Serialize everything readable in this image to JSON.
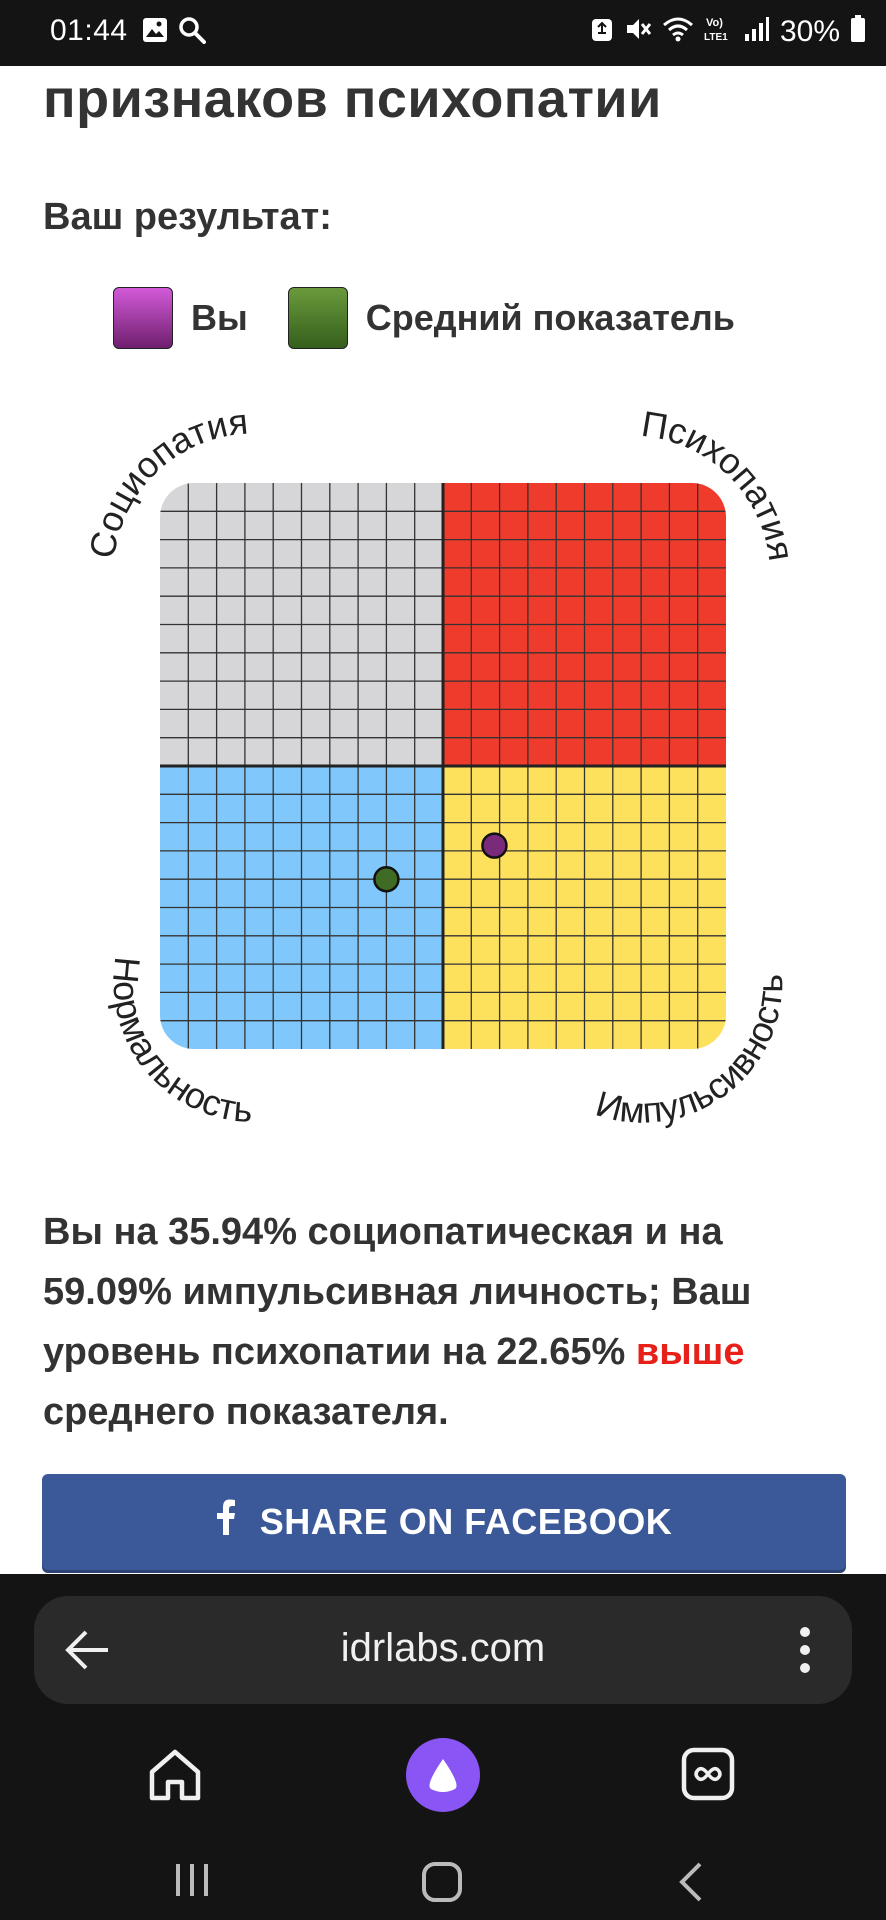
{
  "status_bar": {
    "time": "01:44",
    "left_icons": [
      "image-icon",
      "search-icon"
    ],
    "right_icons": [
      "recycle-icon",
      "mute-icon",
      "wifi-icon",
      "volte-icon",
      "signal-icon",
      "battery-icon"
    ],
    "volte_label": "Vo)\nLTE1",
    "battery_text": "30%"
  },
  "page": {
    "heading": "признаков психопатии",
    "result_label": "Ваш результат:",
    "legend": [
      {
        "label": "Вы",
        "color": "#8e2a8c"
      },
      {
        "label": "Средний показатель",
        "color": "#4b7a2a"
      }
    ]
  },
  "chart_data": {
    "type": "scatter",
    "corner_labels": {
      "top_left": "Социопатия",
      "top_right": "Психопатия",
      "bottom_left": "Нормальность",
      "bottom_right": "Импульсивность"
    },
    "quadrant_colors": {
      "top_left": "#d6d6d8",
      "top_right": "#ef3b2c",
      "bottom_left": "#80c8fb",
      "bottom_right": "#fde05b"
    },
    "grid": true,
    "grid_cells_per_side": 20,
    "xlim": [
      0,
      100
    ],
    "ylim": [
      0,
      100
    ],
    "points": [
      {
        "series": "Вы",
        "x": 59.09,
        "y": 35.94,
        "color": "#7a2a7a"
      },
      {
        "series": "Средний показатель",
        "x": 40,
        "y": 30,
        "color": "#3f6b24"
      }
    ]
  },
  "result": {
    "before": "Вы на 35.94% социопатическая и на 59.09% импульсивная личность; Ваш уровень психопатии на 22.65% ",
    "highlight": "выше",
    "after": " среднего показателя.",
    "highlight_color": "#e8201a"
  },
  "share": {
    "icon": "facebook-icon",
    "label": "SHARE ON FACEBOOK",
    "color": "#3b5998"
  },
  "browser": {
    "url": "idrlabs.com",
    "back_icon": "back-arrow-icon",
    "menu_icon": "more-vert-icon",
    "nav_icons": [
      "home-icon",
      "alice-icon",
      "tabs-icon"
    ]
  },
  "system_nav": [
    "recent-apps-icon",
    "home-button-icon",
    "back-icon"
  ]
}
